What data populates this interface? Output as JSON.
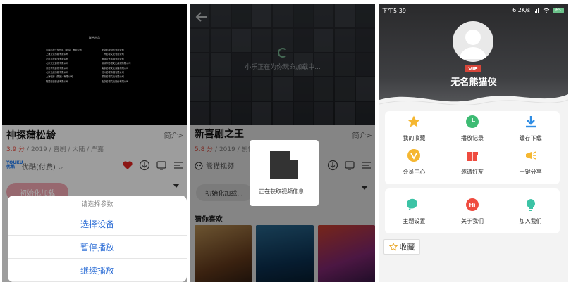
{
  "panel1": {
    "credits_title": "联合出品",
    "credits": [
      "中国影视文化传媒（北京）有限公司",
      "北京影视制作有限公司",
      "上海文化传媒有限公司",
      "广州影视文化有限公司",
      "北京华视影业有限公司",
      "深圳文化传媒有限公司",
      "北京天文影视有限公司",
      "深圳市影视文化传媒有限公司",
      "浙江华策影视有限公司",
      "南京影视文化传播有限公司",
      "北京光线传媒有限公司",
      "杭州影视传媒有限公司",
      "上海电影（集团）有限公司",
      "重庆影视文化有限公司",
      "阿里巴巴影业有限公司",
      "北京影视文化股份有限公司"
    ],
    "title": "神探蒲松龄",
    "intro": "简介>",
    "score": "3.9 分",
    "meta_rest": " / 2019 / 喜剧 / 大陆 / 严嘉",
    "source_logo": "YOUKU 优酷",
    "source_label": "优酷(付费)",
    "chip": "初始化加载",
    "sheet": {
      "hint": "请选择参数",
      "options": [
        "选择设备",
        "暂停播放",
        "继续播放"
      ]
    }
  },
  "panel2": {
    "loading": "小乐正在为你玩命加载中...",
    "title": "新喜剧之王",
    "intro": "简介>",
    "score": "5.8 分",
    "meta_rest": " / 2019 / 剧情",
    "source_label": "熊猫视频",
    "chip": "初始化加载...",
    "section": "猜你喜欢",
    "toast": "正在获取视频信息..."
  },
  "panel3": {
    "time": "下午5:39",
    "speed": "6.2K/s",
    "battery": "65",
    "vip": "VIP",
    "username": "无名熊猫侠",
    "grid1": [
      {
        "label": "我的收藏",
        "icon": "star-icon",
        "color": "#f5b731"
      },
      {
        "label": "播放记录",
        "icon": "clock-icon",
        "color": "#3dbb73"
      },
      {
        "label": "缓存下载",
        "icon": "download-icon",
        "color": "#2f8de4"
      },
      {
        "label": "会员中心",
        "icon": "vip-icon",
        "color": "#f5b731"
      },
      {
        "label": "邀请好友",
        "icon": "gift-icon",
        "color": "#ef4b3f"
      },
      {
        "label": "一键分享",
        "icon": "share-icon",
        "color": "#f5b731"
      }
    ],
    "grid2": [
      {
        "label": "主题设置",
        "icon": "theme-icon",
        "color": "#3cc3a5"
      },
      {
        "label": "关于我们",
        "icon": "about-icon",
        "color": "#ef4b3f"
      },
      {
        "label": "加入我们",
        "icon": "join-icon",
        "color": "#3cc3a5"
      }
    ],
    "fav": "收藏"
  }
}
